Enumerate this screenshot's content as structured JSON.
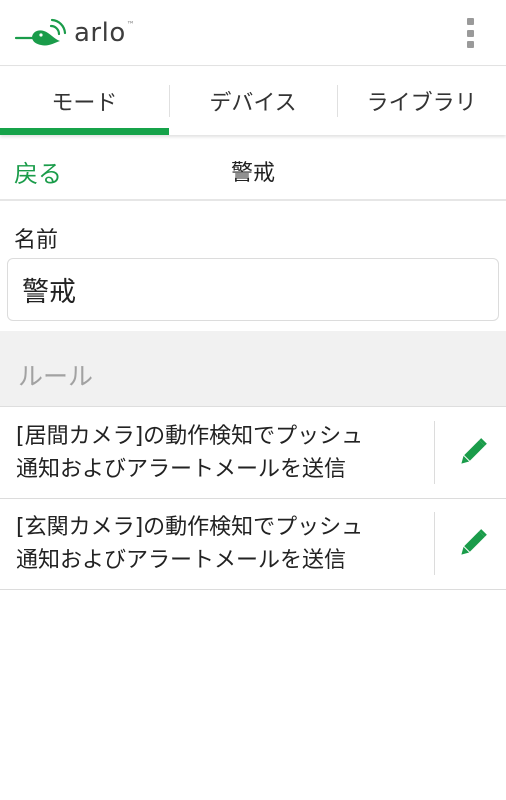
{
  "app": {
    "logo_text": "arlo",
    "logo_tm": "™",
    "brand_color": "#1a9c4a"
  },
  "tabs": [
    {
      "label": "モード",
      "active": true
    },
    {
      "label": "デバイス",
      "active": false
    },
    {
      "label": "ライブラリ",
      "active": false
    }
  ],
  "subheader": {
    "back_label": "戻る",
    "title": "警戒"
  },
  "form": {
    "name_label": "名前",
    "name_value": "警戒"
  },
  "rules": {
    "header": "ルール",
    "items": [
      {
        "line1": "[居間カメラ]の動作検知でプッシュ",
        "line2": "通知およびアラートメールを送信",
        "action_icon": "pencil-icon"
      },
      {
        "line1": "[玄関カメラ]の動作検知でプッシュ",
        "line2": "通知およびアラートメールを送信",
        "action_icon": "pencil-icon"
      }
    ]
  }
}
